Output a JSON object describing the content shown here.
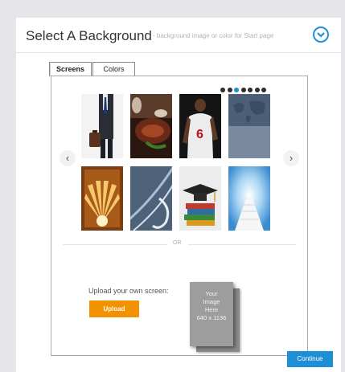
{
  "header": {
    "title": "Select A Background",
    "subtitle": "- background image or color for Start page",
    "collapse_icon": "chevron-down-circle-icon",
    "accent_color": "#1e90d8"
  },
  "tabs": [
    {
      "label": "Screens",
      "active": true
    },
    {
      "label": "Colors",
      "active": false
    }
  ],
  "carousel": {
    "page_count": 7,
    "active_page": 3,
    "prev_icon": "‹",
    "next_icon": "›",
    "thumbnails": [
      {
        "subject": "businessman-with-briefcase"
      },
      {
        "subject": "steak-and-wine"
      },
      {
        "subject": "basketball-player-6"
      },
      {
        "subject": "world-map-blue"
      },
      {
        "subject": "golden-sunburst"
      },
      {
        "subject": "abstract-blue-curves"
      },
      {
        "subject": "graduation-cap-on-books"
      },
      {
        "subject": "sky-stairway"
      }
    ]
  },
  "divider": {
    "label": "OR"
  },
  "upload": {
    "label": "Upload your own screen:",
    "button_label": "Upload",
    "button_color": "#f39200",
    "placeholder_lines": [
      "Your",
      "Image",
      "Here",
      "640 x 1136"
    ]
  },
  "footer": {
    "continue_label": "Continue",
    "continue_color": "#1e8fd6"
  }
}
